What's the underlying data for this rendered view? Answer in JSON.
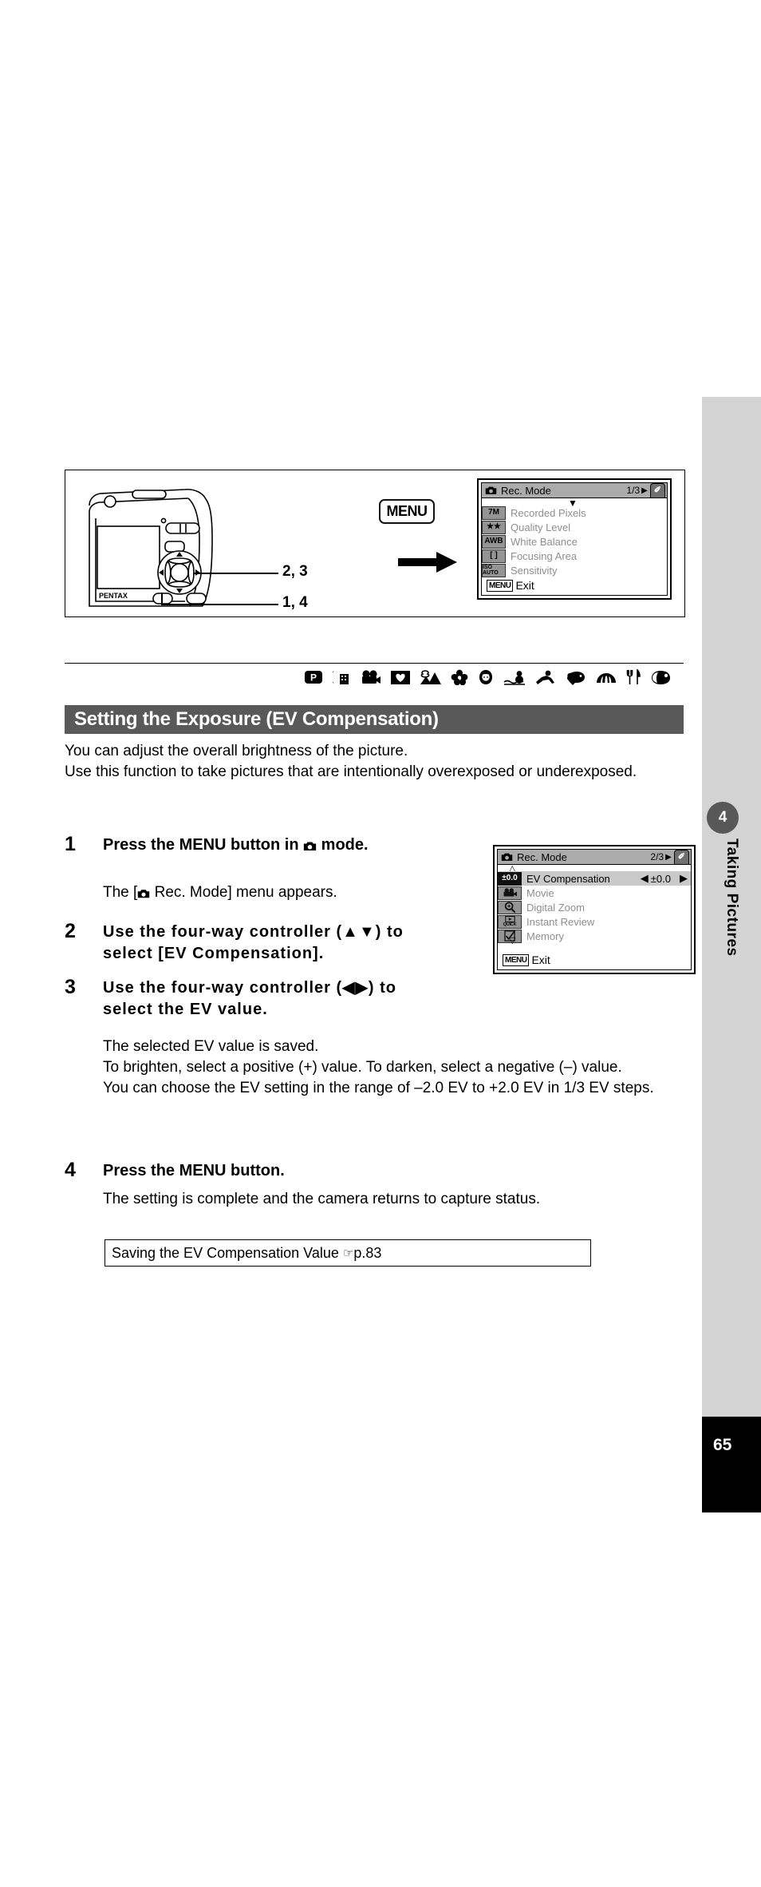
{
  "page": {
    "number": "65",
    "chapter_number": "4",
    "chapter_label": "Taking Pictures"
  },
  "illustration": {
    "callout_top": "2, 3",
    "callout_bottom": "1, 4",
    "menu_button_label": "MENU",
    "camera_brand": "PENTAX",
    "arrow_icon": "right-arrow-icon"
  },
  "lcd_screen_1": {
    "title": "Rec. Mode",
    "page_indicator": "1/3",
    "next_tab_arrow": "▶",
    "tab_label": "✐",
    "camera_icon": "camera-icon",
    "down_caret": "▼",
    "rows": [
      {
        "icon": "7M",
        "label": "Recorded Pixels"
      },
      {
        "icon": "★★",
        "label": "Quality Level"
      },
      {
        "icon": "AWB",
        "label": "White Balance"
      },
      {
        "icon": "[  ]",
        "label": "Focusing Area"
      },
      {
        "icon": "ISO AUTO",
        "label": "Sensitivity"
      }
    ],
    "footer_chip": "MENU",
    "footer_label": "Exit"
  },
  "lcd_screen_2": {
    "title": "Rec. Mode",
    "page_indicator": "2/3",
    "next_tab_arrow": "▶",
    "tab_label": "✐",
    "camera_icon": "camera-icon",
    "up_caret": "△",
    "down_caret": "▽",
    "rows": [
      {
        "icon": "±0.0",
        "label": "EV Compensation",
        "value_left": "◀",
        "value": "±0.0",
        "value_right": "▶",
        "selected": true
      },
      {
        "icon": "movie-icon",
        "label": "Movie",
        "selected": false
      },
      {
        "icon": "magnifier-icon",
        "label": "Digital Zoom",
        "selected": false
      },
      {
        "icon": "quick-icon",
        "label": "Instant Review",
        "selected": false
      },
      {
        "icon": "checkbox-icon",
        "label": "Memory",
        "selected": false
      }
    ],
    "footer_chip": "MENU",
    "footer_label": "Exit"
  },
  "mode_icons": [
    "program-mode-icon",
    "night-scene-icon",
    "movie-mode-icon",
    "frame-composite-icon",
    "landscape-icon",
    "flower-icon",
    "portrait-icon",
    "surf-snow-icon",
    "sport-icon",
    "pet-icon",
    "food-icon",
    "fork-knife-icon",
    "self-portrait-icon"
  ],
  "heading": "Setting the Exposure (EV Compensation)",
  "intro": [
    "You can adjust the overall brightness of the picture.",
    "Use this function to take pictures that are intentionally overexposed or underexposed."
  ],
  "steps": [
    {
      "number": "1",
      "title_before": "Press the MENU button in ",
      "title_icon": "camera-icon",
      "title_after": " mode.",
      "body": [
        {
          "before": "The [",
          "icon": "camera-icon",
          "after": " Rec. Mode] menu appears."
        }
      ]
    },
    {
      "number": "2",
      "title": "Use the four-way controller (▲▼) to select [EV Compensation].",
      "body": []
    },
    {
      "number": "3",
      "title": "Use the four-way controller (◀▶) to select the EV value.",
      "body": [
        "The selected EV value is saved.",
        "To brighten, select a positive (+) value. To darken, select a negative (–) value.",
        "You can choose the EV setting in the range of –2.0 EV to +2.0 EV in 1/3 EV steps."
      ]
    },
    {
      "number": "4",
      "title": "Press the MENU button.",
      "body": [
        "The setting is complete and the camera returns to capture status."
      ]
    }
  ],
  "note_box": {
    "text": "Saving the EV Compensation Value",
    "ref_icon": "☞",
    "ref": "p.83"
  },
  "colors": {
    "heading_bg": "#595959",
    "rail_bg": "#d4d4d4",
    "page_tab_bg": "#000000",
    "lcd_titlebar": "#ababab",
    "lcd_selected": "#c9c9c9",
    "lcd_disabled_text": "#8e8e8e"
  }
}
